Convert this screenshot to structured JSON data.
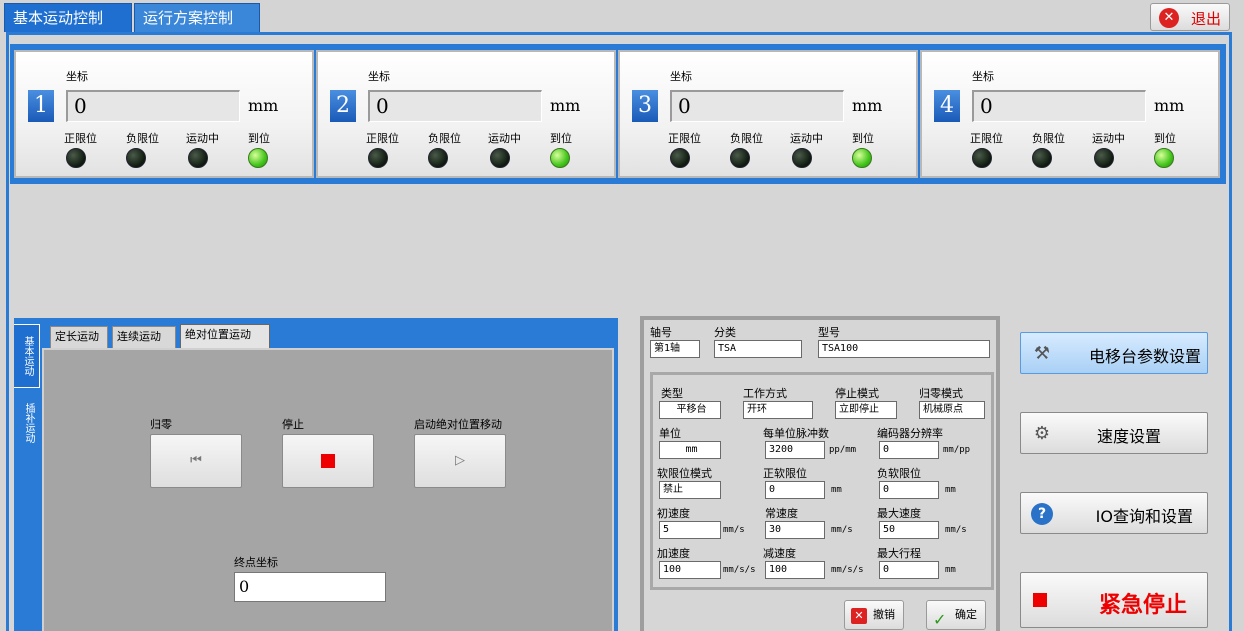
{
  "window": {
    "tabs": [
      "基本运动控制",
      "运行方案控制"
    ],
    "exit_label": "退出"
  },
  "axes": [
    {
      "number": "1",
      "coord_label": "坐标",
      "value": "0",
      "unit": "mm",
      "leds": [
        {
          "label": "正限位",
          "on": false
        },
        {
          "label": "负限位",
          "on": false
        },
        {
          "label": "运动中",
          "on": false
        },
        {
          "label": "到位",
          "on": true
        }
      ]
    },
    {
      "number": "2",
      "coord_label": "坐标",
      "value": "0",
      "unit": "mm",
      "leds": [
        {
          "label": "正限位",
          "on": false
        },
        {
          "label": "负限位",
          "on": false
        },
        {
          "label": "运动中",
          "on": false
        },
        {
          "label": "到位",
          "on": true
        }
      ]
    },
    {
      "number": "3",
      "coord_label": "坐标",
      "value": "0",
      "unit": "mm",
      "leds": [
        {
          "label": "正限位",
          "on": false
        },
        {
          "label": "负限位",
          "on": false
        },
        {
          "label": "运动中",
          "on": false
        },
        {
          "label": "到位",
          "on": true
        }
      ]
    },
    {
      "number": "4",
      "coord_label": "坐标",
      "value": "0",
      "unit": "mm",
      "leds": [
        {
          "label": "正限位",
          "on": false
        },
        {
          "label": "负限位",
          "on": false
        },
        {
          "label": "运动中",
          "on": false
        },
        {
          "label": "到位",
          "on": true
        }
      ]
    }
  ],
  "motion": {
    "vertical_tabs": [
      "基本运动",
      "插补运动"
    ],
    "inner_tabs": [
      "定长运动",
      "连续运动",
      "绝对位置运动"
    ],
    "home_label": "归零",
    "home_glyph": "⏮",
    "stop_label": "停止",
    "start_label": "启动绝对位置移动",
    "start_glyph": "▷",
    "end_coord_label": "终点坐标",
    "end_coord_value": "0"
  },
  "params": {
    "axis_label": "轴号",
    "axis_value": "第1轴",
    "class_label": "分类",
    "class_value": "TSA",
    "model_label": "型号",
    "model_value": "TSA100",
    "type_label": "类型",
    "type_value": "平移台",
    "work_label": "工作方式",
    "work_value": "开环",
    "stopmode_label": "停止模式",
    "stopmode_value": "立即停止",
    "homemode_label": "归零模式",
    "homemode_value": "机械原点",
    "unit_label": "单位",
    "unit_value": "mm",
    "pulse_label": "每单位脉冲数",
    "pulse_value": "3200",
    "pulse_unit": "pp/mm",
    "enc_label": "编码器分辨率",
    "enc_value": "0",
    "enc_unit": "mm/pp",
    "softmode_label": "软限位模式",
    "softmode_value": "禁止",
    "possoft_label": "正软限位",
    "possoft_value": "0",
    "possoft_unit": "mm",
    "negsoft_label": "负软限位",
    "negsoft_value": "0",
    "negsoft_unit": "mm",
    "initspeed_label": "初速度",
    "initspeed_value": "5",
    "initspeed_unit": "mm/s",
    "speed_label": "常速度",
    "speed_value": "30",
    "speed_unit": "mm/s",
    "maxspeed_label": "最大速度",
    "maxspeed_value": "50",
    "maxspeed_unit": "mm/s",
    "acc_label": "加速度",
    "acc_value": "100",
    "acc_unit": "mm/s/s",
    "dec_label": "减速度",
    "dec_value": "100",
    "dec_unit": "mm/s/s",
    "maxtravel_label": "最大行程",
    "maxtravel_value": "0",
    "maxtravel_unit": "mm",
    "cancel_label": "撤销",
    "ok_label": "确定"
  },
  "right_buttons": {
    "stage_label": "电移台参数设置",
    "speed_label": "速度设置",
    "io_label": "IO查询和设置",
    "estop_label": "紧急停止"
  }
}
